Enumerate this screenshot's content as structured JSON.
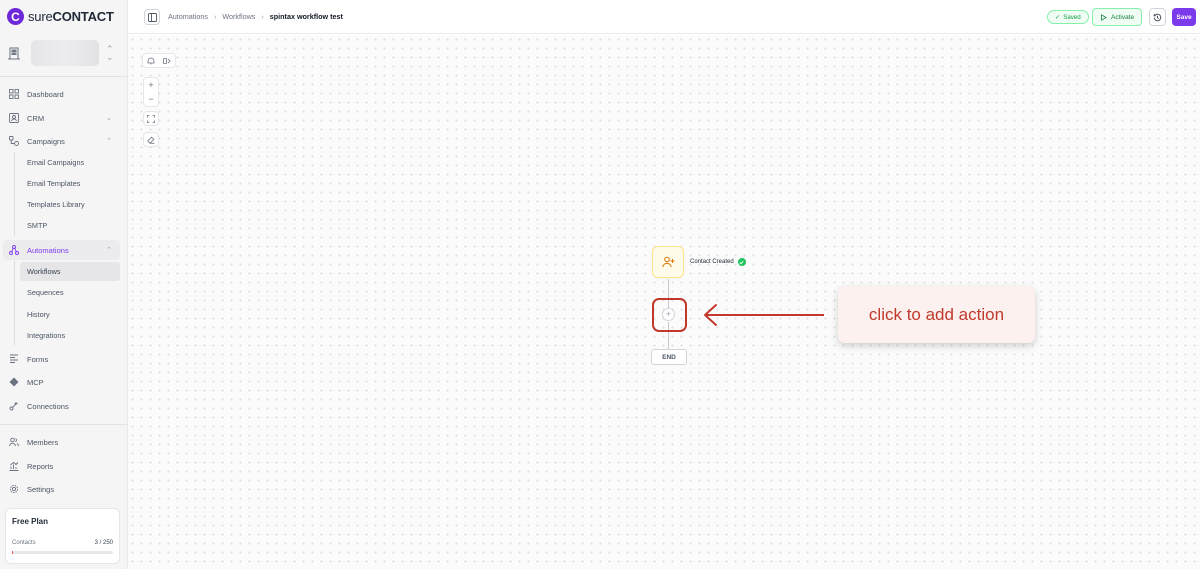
{
  "app": {
    "logo_text_light": "sure",
    "logo_text_bold": "CONTACT",
    "logo_mark": "C"
  },
  "sidebar": {
    "nav": [
      {
        "label": "Dashboard",
        "icon": "dashboard-icon"
      },
      {
        "label": "CRM",
        "icon": "crm-icon"
      },
      {
        "label": "Campaigns",
        "icon": "campaigns-icon"
      },
      {
        "label": "Automations",
        "icon": "automations-icon"
      },
      {
        "label": "Forms",
        "icon": "forms-icon"
      },
      {
        "label": "MCP",
        "icon": "mcp-icon"
      },
      {
        "label": "Connections",
        "icon": "connections-icon"
      },
      {
        "label": "Members",
        "icon": "members-icon"
      },
      {
        "label": "Reports",
        "icon": "reports-icon"
      },
      {
        "label": "Settings",
        "icon": "settings-icon"
      }
    ],
    "campaigns_sub": [
      "Email Campaigns",
      "Email Templates",
      "Templates Library",
      "SMTP"
    ],
    "automations_sub": [
      "Workflows",
      "Sequences",
      "History",
      "Integrations"
    ],
    "plan": {
      "title": "Free Plan",
      "contacts_label": "Contacts",
      "contacts_value": "3 / 250",
      "usage_fraction": 0.012
    }
  },
  "header": {
    "breadcrumb": [
      "Automations",
      "Workflows",
      "spintax workflow test"
    ],
    "saved_label": "Saved",
    "activate_label": "Activate",
    "save_label": "Save"
  },
  "canvas": {
    "trigger_label": "Contact Created",
    "end_label": "END",
    "add_symbol": "+",
    "callout_text": "click to add action"
  },
  "colors": {
    "accent": "#7c3aed",
    "success": "#22c55e",
    "annotation": "#c0392b"
  }
}
